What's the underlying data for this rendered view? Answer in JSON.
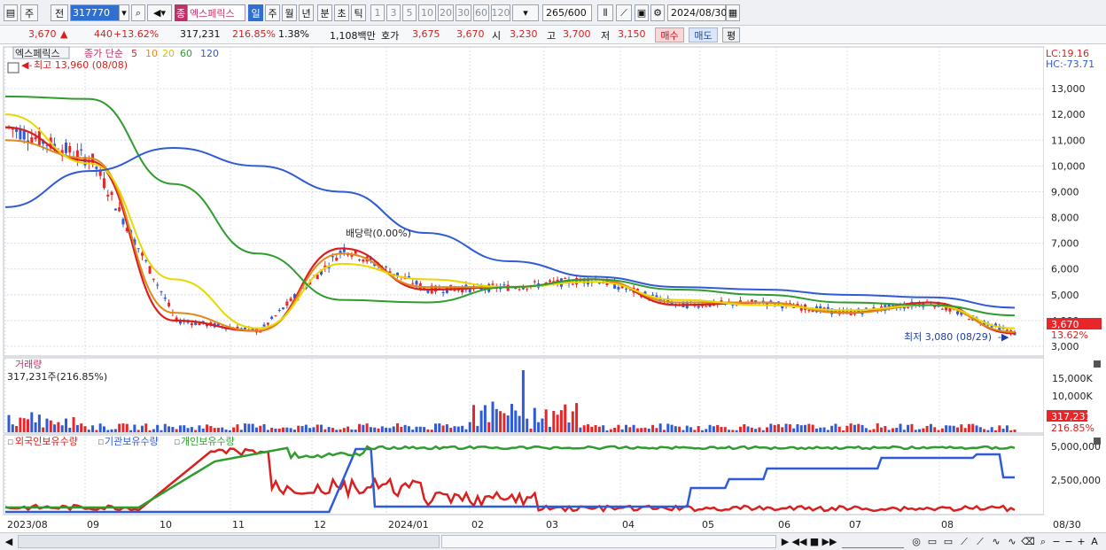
{
  "toolbar": {
    "mode": "주",
    "prev": "전",
    "code": "317770",
    "name_tag": "종",
    "name": "엑스페릭스",
    "periods": [
      "일",
      "주",
      "월",
      "년",
      "분",
      "초",
      "틱"
    ],
    "numbers": [
      "1",
      "3",
      "5",
      "10",
      "20",
      "30",
      "60",
      "120"
    ],
    "count": "265",
    "count_total": "/600",
    "date": "2024/08/30"
  },
  "infobar": {
    "price": "3,670",
    "arrow": "▲",
    "change": "440",
    "change_pct": "+13.62%",
    "volume": "317,231",
    "volume_pct": "216.85%",
    "turnover": "1.38%",
    "amount": "1,108백만",
    "bid_label": "호가",
    "bid1": "3,675",
    "bid2": "3,670",
    "open_label": "시",
    "open": "3,230",
    "high_label": "고",
    "high": "3,700",
    "low_label": "저",
    "low": "3,150",
    "buy": "매수",
    "sell": "매도",
    "eval": "평"
  },
  "legend": {
    "name": "엑스페릭스",
    "ma": "종가 단순",
    "ma_periods": [
      "5",
      "10",
      "20",
      "60",
      "120"
    ],
    "ma_colors": [
      "#d8201e",
      "#e08a1e",
      "#e8d800",
      "#2e9d2e",
      "#2f5bd6"
    ],
    "high_marker": "최고 13,960 (08/08)",
    "low_marker": "최저 3,080 (08/29)",
    "dividend": "배당락(0.00%)",
    "lc": "LC:19.16",
    "hc": "HC:-73.71",
    "price_box": "3,670",
    "price_pct": "13.62%"
  },
  "volume_pane": {
    "title": "거래량",
    "value": "317,231주(216.85%)",
    "axis": [
      "15,000K",
      "10,000K"
    ],
    "box": "317,231",
    "pct": "216.85%"
  },
  "holdings_pane": {
    "labels": [
      "외국인보유수량",
      "기관보유수량",
      "개인보유수량"
    ],
    "colors": [
      "#d8201e",
      "#2f5bd6",
      "#2e9d2e"
    ],
    "axis": [
      "5,000,000",
      "2,500,000"
    ]
  },
  "price_axis": [
    "13,000",
    "12,000",
    "11,000",
    "10,000",
    "9,000",
    "8,000",
    "7,000",
    "6,000",
    "5,000",
    "4,000",
    "3,000"
  ],
  "date_axis": [
    "2023/08",
    "09",
    "10",
    "11",
    "12",
    "2024/01",
    "02",
    "03",
    "04",
    "05",
    "06",
    "07",
    "08",
    "08/30"
  ],
  "chart_data": {
    "type": "line",
    "title": "엑스페릭스",
    "x": [
      "2023/08",
      "2023/09",
      "2023/10",
      "2023/11",
      "2023/12",
      "2024/01",
      "2024/02",
      "2024/03",
      "2024/04",
      "2024/05",
      "2024/06",
      "2024/07",
      "2024/08"
    ],
    "series": [
      {
        "name": "5",
        "values": [
          11500,
          10200,
          4000,
          3600,
          6800,
          5200,
          5300,
          5600,
          4600,
          4700,
          4300,
          4700,
          3500
        ]
      },
      {
        "name": "10",
        "values": [
          11000,
          10300,
          4300,
          3600,
          6600,
          5300,
          5300,
          5600,
          4700,
          4700,
          4300,
          4600,
          3550
        ]
      },
      {
        "name": "20",
        "values": [
          12000,
          10100,
          5600,
          3700,
          6200,
          5600,
          5300,
          5500,
          4800,
          4600,
          4400,
          4600,
          3700
        ]
      },
      {
        "name": "60",
        "values": [
          12700,
          12600,
          9300,
          6600,
          4800,
          4700,
          5300,
          5600,
          5200,
          5000,
          4700,
          4600,
          4200
        ]
      },
      {
        "name": "120",
        "values": [
          8400,
          9800,
          10700,
          10000,
          9000,
          7400,
          6300,
          5700,
          5300,
          5200,
          5000,
          4900,
          4500
        ]
      }
    ],
    "ylim": [
      3000,
      14000
    ],
    "high": 13960,
    "low": 3080,
    "grid": true
  }
}
